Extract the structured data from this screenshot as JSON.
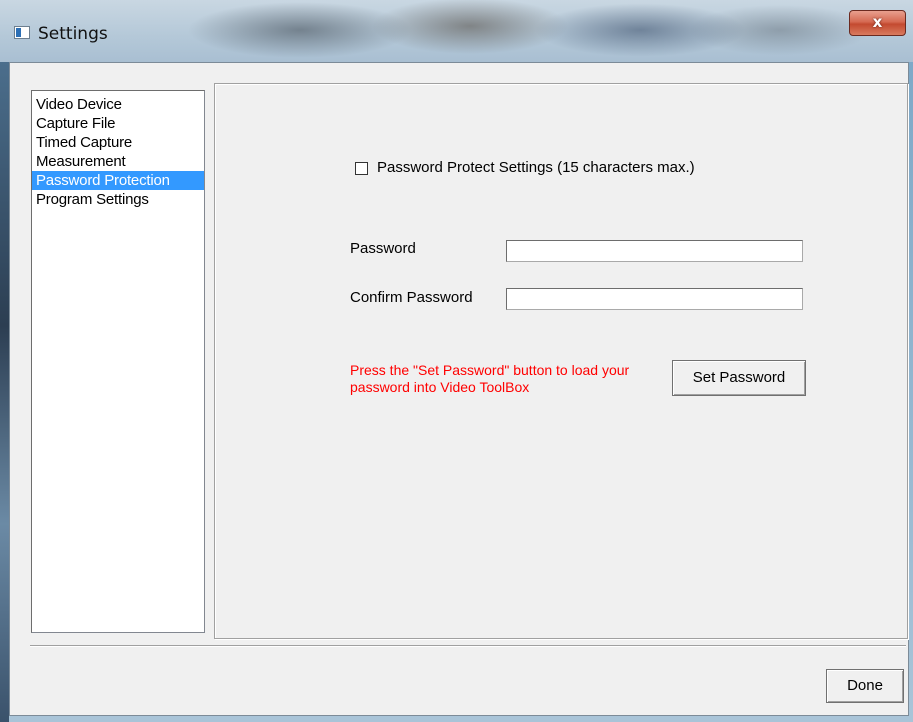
{
  "window": {
    "title": "Settings",
    "close_glyph": "x"
  },
  "nav": {
    "items": [
      {
        "label": "Video Device",
        "selected": false
      },
      {
        "label": "Capture File",
        "selected": false
      },
      {
        "label": "Timed Capture",
        "selected": false
      },
      {
        "label": "Measurement",
        "selected": false
      },
      {
        "label": "Password Protection",
        "selected": true
      },
      {
        "label": "Program Settings",
        "selected": false
      }
    ]
  },
  "password": {
    "protect_label": "Password Protect Settings (15 characters max.)",
    "protect_checked": false,
    "password_label": "Password",
    "password_value": "",
    "confirm_label": "Confirm Password",
    "confirm_value": "",
    "note": "Press the \"Set Password\" button to load your password into Video ToolBox",
    "set_button": "Set Password"
  },
  "footer": {
    "done_button": "Done"
  },
  "colors": {
    "selection": "#3399ff",
    "note_text": "#ff0000",
    "dialog_bg": "#f0f0f0"
  }
}
